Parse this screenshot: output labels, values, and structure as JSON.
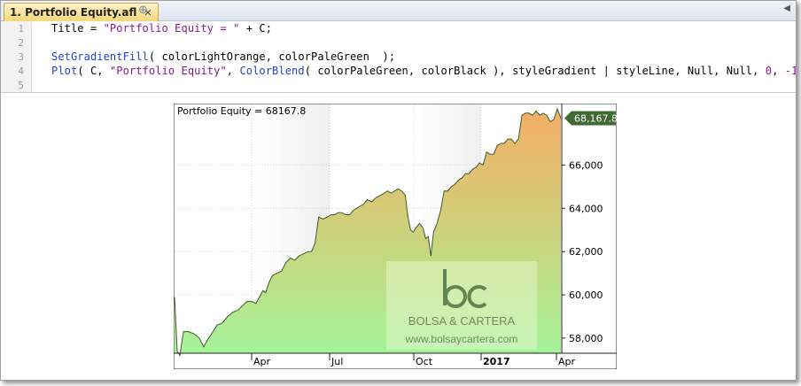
{
  "tab": {
    "title": "1. Portfolio Equity.afl",
    "close_icon": "close-icon",
    "new_tab_icon": "plus-icon",
    "menu_icon": "chevron-down-icon"
  },
  "editor": {
    "line_numbers": [
      "1",
      "2",
      "3",
      "4",
      "5"
    ],
    "lines": [
      [
        [
          "kw",
          "Title"
        ],
        [
          "kw",
          " = "
        ],
        [
          "str",
          "\"Portfolio Equity = \""
        ],
        [
          "kw",
          " + C;"
        ]
      ],
      [],
      [
        [
          "fn",
          "SetGradientFill"
        ],
        [
          "kw",
          "( colorLightOrange, colorPaleGreen  );"
        ]
      ],
      [
        [
          "fn",
          "Plot"
        ],
        [
          "kw",
          "( C, "
        ],
        [
          "str",
          "\"Portfolio Equity\""
        ],
        [
          "kw",
          ", "
        ],
        [
          "fn",
          "ColorBlend"
        ],
        [
          "kw",
          "( colorPaleGreen, colorBlack ), styleGradient | styleLine, Null, Null, "
        ],
        [
          "num",
          "0"
        ],
        [
          "kw",
          ", "
        ],
        [
          "num",
          "-1"
        ],
        [
          "kw",
          " );"
        ]
      ],
      []
    ]
  },
  "chart_data": {
    "type": "area",
    "title": "Portfolio Equity = 68167.8",
    "x_ticks": [
      "Apr",
      "Jul",
      "Oct",
      "2017",
      "Apr"
    ],
    "y_ticks": [
      "58,000",
      "60,000",
      "62,000",
      "64,000",
      "66,000"
    ],
    "ylim": [
      57300,
      68800
    ],
    "last_value_label": "68,167.8",
    "grid": true,
    "colors": {
      "fill_top": "#f4ae64",
      "fill_bottom": "#a4f49a",
      "line": "#3d5a28",
      "value_badge": "#3f6a34"
    },
    "watermark": {
      "brand": "BOLSA & CARTERA",
      "url": "www.bolsaycartera.com",
      "logo": "bc-logo"
    },
    "points": [
      [
        0,
        59900
      ],
      [
        3,
        57400
      ],
      [
        6,
        57200
      ],
      [
        10,
        58300
      ],
      [
        16,
        58300
      ],
      [
        22,
        58200
      ],
      [
        28,
        58000
      ],
      [
        33,
        57600
      ],
      [
        37,
        57900
      ],
      [
        42,
        58200
      ],
      [
        48,
        58600
      ],
      [
        54,
        58700
      ],
      [
        60,
        59000
      ],
      [
        66,
        59200
      ],
      [
        72,
        59300
      ],
      [
        77,
        59500
      ],
      [
        82,
        59700
      ],
      [
        87,
        59700
      ],
      [
        92,
        59600
      ],
      [
        96,
        59900
      ],
      [
        100,
        60200
      ],
      [
        103,
        60100
      ],
      [
        107,
        60600
      ],
      [
        111,
        60900
      ],
      [
        116,
        61000
      ],
      [
        121,
        61100
      ],
      [
        126,
        61500
      ],
      [
        131,
        61700
      ],
      [
        136,
        61600
      ],
      [
        141,
        61800
      ],
      [
        146,
        61900
      ],
      [
        151,
        62000
      ],
      [
        155,
        62000
      ],
      [
        159,
        62400
      ],
      [
        163,
        63600
      ],
      [
        168,
        63500
      ],
      [
        173,
        63600
      ],
      [
        177,
        63700
      ],
      [
        181,
        63700
      ],
      [
        185,
        63800
      ],
      [
        189,
        63800
      ],
      [
        194,
        63700
      ],
      [
        198,
        63700
      ],
      [
        202,
        63900
      ],
      [
        206,
        64000
      ],
      [
        210,
        64100
      ],
      [
        214,
        64200
      ],
      [
        218,
        64400
      ],
      [
        223,
        64300
      ],
      [
        228,
        64500
      ],
      [
        233,
        64600
      ],
      [
        237,
        64700
      ],
      [
        241,
        64800
      ],
      [
        245,
        64700
      ],
      [
        249,
        64800
      ],
      [
        253,
        64900
      ],
      [
        257,
        64800
      ],
      [
        261,
        64600
      ],
      [
        264,
        63600
      ],
      [
        267,
        63000
      ],
      [
        270,
        62900
      ],
      [
        273,
        63100
      ],
      [
        277,
        63300
      ],
      [
        281,
        63100
      ],
      [
        284,
        62600
      ],
      [
        287,
        62700
      ],
      [
        290,
        61800
      ],
      [
        293,
        62900
      ],
      [
        297,
        63300
      ],
      [
        301,
        63900
      ],
      [
        305,
        64800
      ],
      [
        309,
        64800
      ],
      [
        313,
        65000
      ],
      [
        317,
        65100
      ],
      [
        321,
        65300
      ],
      [
        325,
        65400
      ],
      [
        329,
        65600
      ],
      [
        333,
        65600
      ],
      [
        337,
        65800
      ],
      [
        341,
        65900
      ],
      [
        345,
        66100
      ],
      [
        349,
        66000
      ],
      [
        353,
        66600
      ],
      [
        357,
        66500
      ],
      [
        361,
        66500
      ],
      [
        365,
        66900
      ],
      [
        369,
        67000
      ],
      [
        373,
        67000
      ],
      [
        377,
        67200
      ],
      [
        381,
        67200
      ],
      [
        385,
        67000
      ],
      [
        389,
        67200
      ],
      [
        393,
        68300
      ],
      [
        397,
        68400
      ],
      [
        401,
        68400
      ],
      [
        405,
        68300
      ],
      [
        409,
        68500
      ],
      [
        413,
        68300
      ],
      [
        417,
        68400
      ],
      [
        421,
        68300
      ],
      [
        425,
        68000
      ],
      [
        429,
        68100
      ],
      [
        433,
        68600
      ],
      [
        437,
        68167.8
      ]
    ],
    "x_range": [
      0,
      437
    ]
  }
}
